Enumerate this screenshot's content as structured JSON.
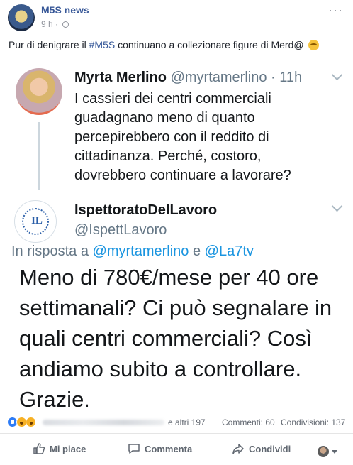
{
  "post": {
    "page_name": "M5S news",
    "time": "9 h",
    "text_before": "Pur di denigrare il ",
    "hashtag": "#M5S",
    "text_after": " continuano a collezionare figure di Merd@",
    "more_icon": "more-dots-icon",
    "privacy_icon": "globe-icon"
  },
  "tweet1": {
    "name": "Myrta Merlino",
    "handle": "@myrtamerlino · 11h",
    "body": "I cassieri dei centri commerciali guadagnano meno di quanto percepirebbero con il reddito di cittadinanza. Perché, costoro, dovrebbero continuare a lavorare?"
  },
  "tweet2": {
    "logo_letter": "IL",
    "name": "IspettoratoDelLavoro",
    "handle": "@IspettLavoro",
    "reply_prefix": "In risposta a ",
    "mention1": "@myrtamerlino",
    "reply_and": " e ",
    "mention2": "@La7tv",
    "body": "Meno di 780€/mese per 40 ore settimanali? Ci può segnalare in quali centri commerciali? Così andiamo subito a controllare. Grazie."
  },
  "reactions": {
    "icons": [
      "like-reaction-icon",
      "haha-reaction-icon",
      "wow-reaction-icon"
    ],
    "others": "e altri 197",
    "comments": "Commenti: 60",
    "shares": "Condivisioni: 137"
  },
  "actions": {
    "like": "Mi piace",
    "comment": "Commenta",
    "share": "Condividi"
  }
}
